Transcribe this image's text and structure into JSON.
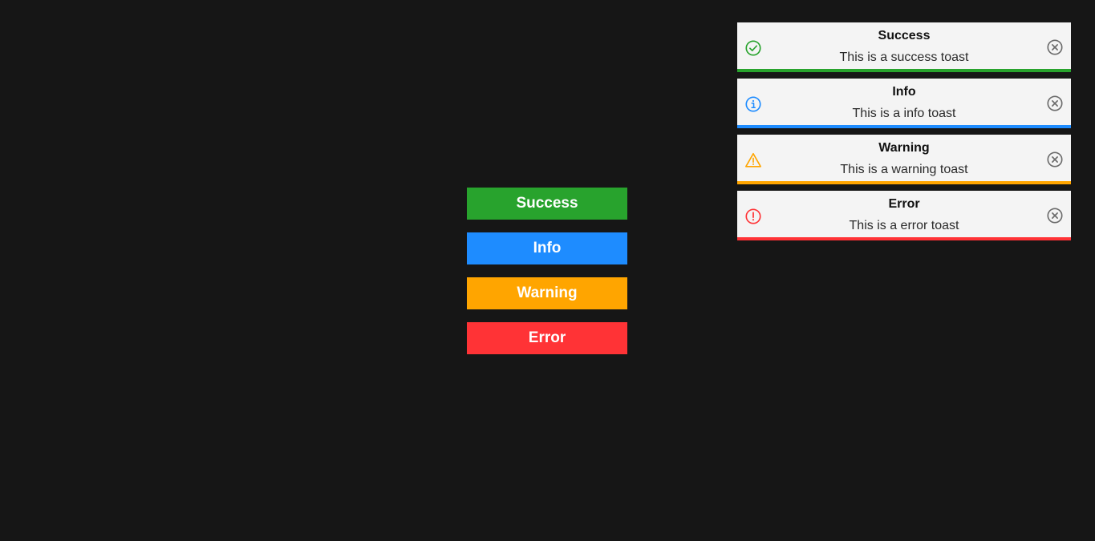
{
  "colors": {
    "background": "#161616",
    "success": "#28a32d",
    "info": "#1e8cff",
    "warning": "#ffa500",
    "error": "#ff3336",
    "close": "#6b6b6b"
  },
  "buttons": [
    {
      "label": "Success"
    },
    {
      "label": "Info"
    },
    {
      "label": "Warning"
    },
    {
      "label": "Error"
    }
  ],
  "toasts": [
    {
      "title": "Success",
      "message": "This is a success toast",
      "icon": "check-circle-icon"
    },
    {
      "title": "Info",
      "message": "This is a info toast",
      "icon": "info-circle-icon"
    },
    {
      "title": "Warning",
      "message": "This is a warning toast",
      "icon": "warning-triangle-icon"
    },
    {
      "title": "Error",
      "message": "This is a error toast",
      "icon": "error-circle-icon"
    }
  ]
}
